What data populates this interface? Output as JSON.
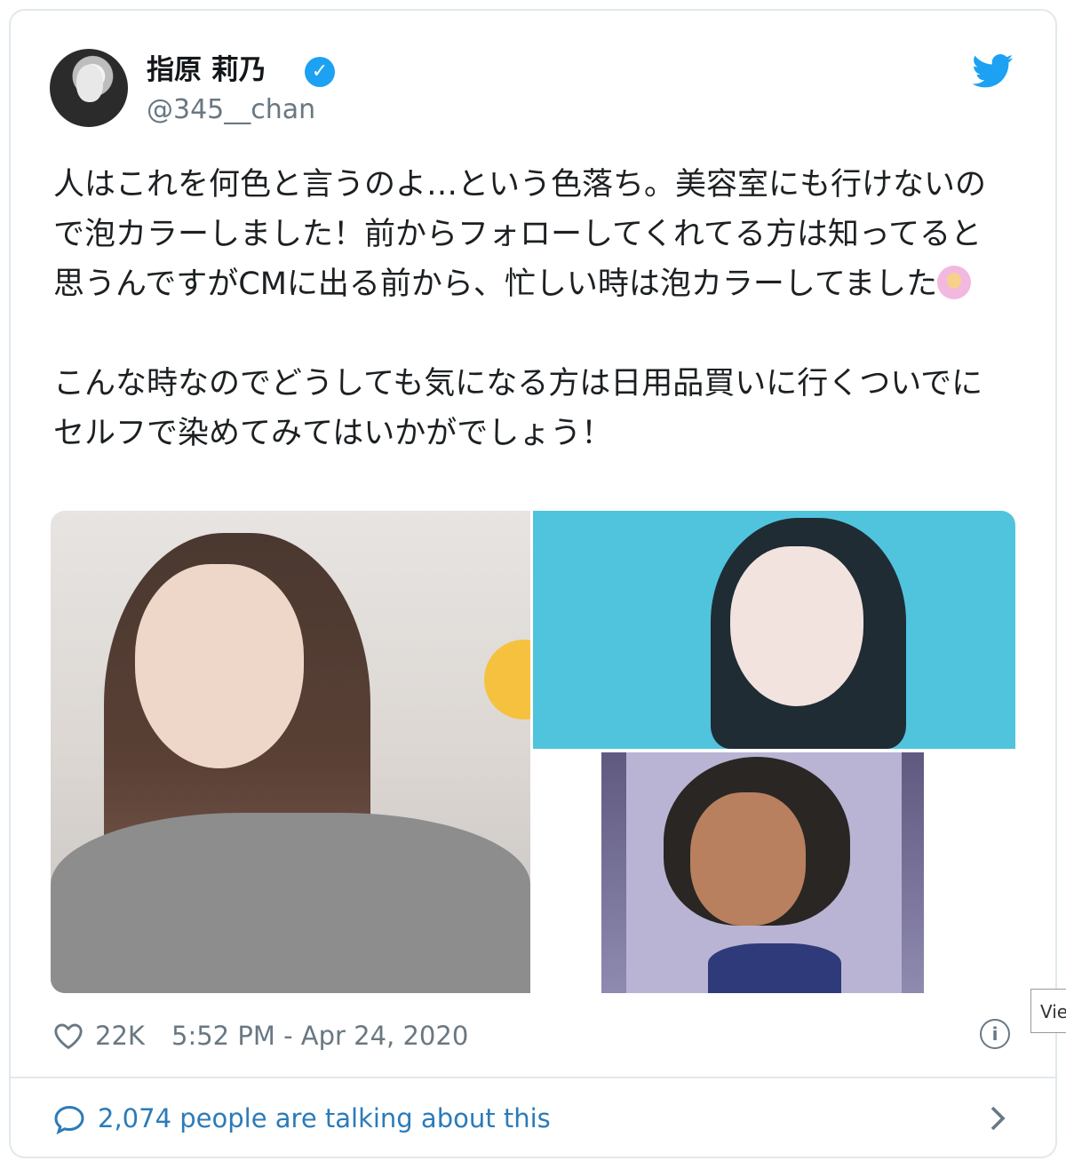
{
  "user": {
    "name": "指原 莉乃",
    "handle": "@345__chan",
    "verified": true
  },
  "tweet": {
    "paragraph1": "人はこれを何色と言うのよ…という色落ち。美容室にも行けないので泡カラーしました！前からフォローしてくれてる方は知ってると思うんですがCMに出る前から、忙しい時は泡カラーしてました",
    "paragraph2": "こんな時なのでどうしても気になる方は日用品買いに行くついでにセルフで染めてみてはいかがでしょう！",
    "emoji": "person-gesturing-ok-emoji"
  },
  "footer": {
    "likes": "22K",
    "timestamp": "5:52 PM - Apr 24, 2020",
    "info_symbol": "i",
    "talking": "2,074 people are talking about this"
  },
  "tooltip": {
    "text": "Vie"
  },
  "colors": {
    "link": "#2b7bb9",
    "meta": "#697882",
    "twitter_blue": "#1da1f2",
    "border": "#e1e8ed"
  },
  "icons": [
    "twitter-bird-icon",
    "verified-badge-icon",
    "heart-icon",
    "info-icon",
    "comment-icon",
    "chevron-right-icon"
  ]
}
